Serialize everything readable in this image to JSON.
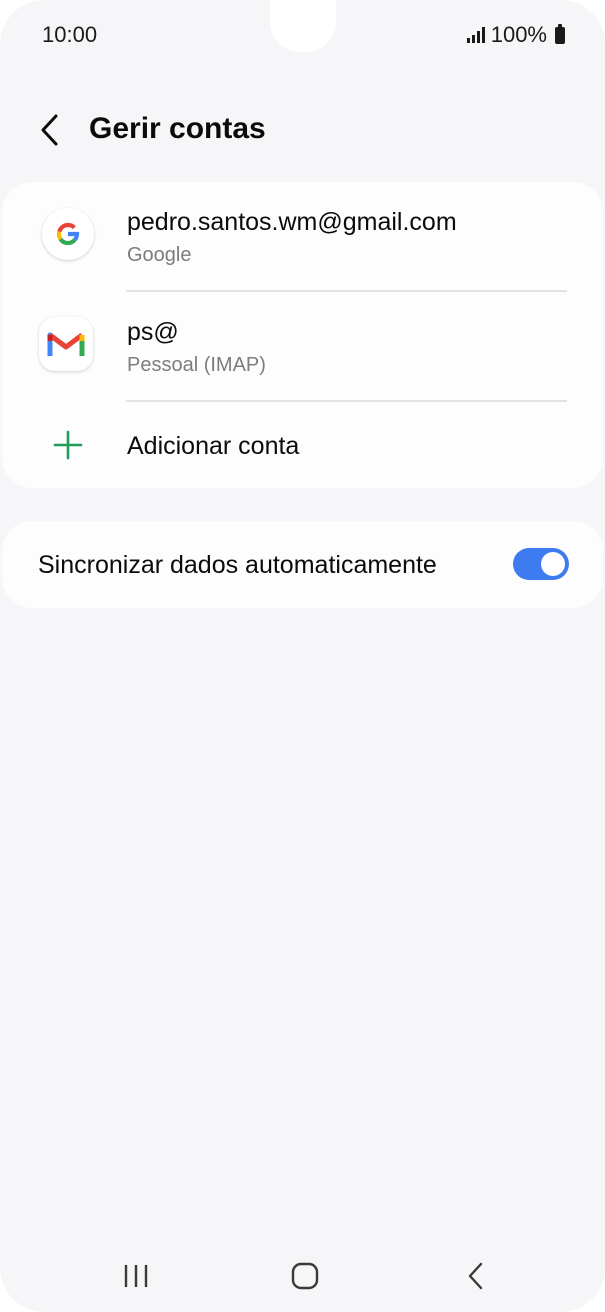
{
  "status_bar": {
    "time": "10:00",
    "battery_text": "100%"
  },
  "header": {
    "title": "Gerir contas"
  },
  "accounts": [
    {
      "title": "pedro.santos.wm@gmail.com",
      "subtitle": "Google",
      "icon": "google-icon"
    },
    {
      "title": "ps@",
      "subtitle": "Pessoal (IMAP)",
      "icon": "gmail-icon"
    }
  ],
  "add_account": {
    "label": "Adicionar conta",
    "icon": "plus-icon"
  },
  "sync": {
    "label": "Sincronizar dados automaticamente",
    "enabled": true
  },
  "colors": {
    "accent": "#3e7bf0",
    "plus_green": "#1f9c5a",
    "background": "#f6f6f8"
  },
  "navbar": {
    "icons": [
      "recent-apps-icon",
      "home-icon",
      "back-icon"
    ]
  }
}
